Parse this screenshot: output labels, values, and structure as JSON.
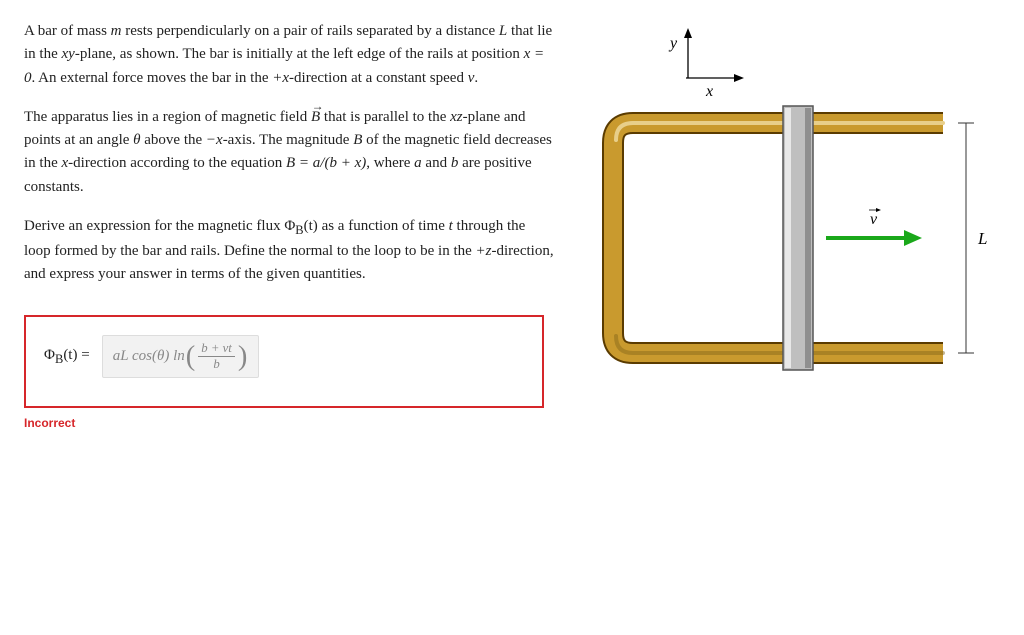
{
  "problem": {
    "p1_a": "A bar of mass ",
    "p1_b": " rests perpendicularly on a pair of rails separated by a distance ",
    "p1_c": " that lie in the ",
    "p1_d": "-plane, as shown. The bar is initially at the left edge of the rails at position ",
    "p1_e": ". An external force moves the bar in the ",
    "p1_f": "-direction at a constant speed ",
    "p1_g": ".",
    "m": "m",
    "L": "L",
    "xy": "xy",
    "x0": "x = 0",
    "plusx": "+x",
    "v": "v",
    "p2_a": "The apparatus lies in a region of magnetic field ",
    "p2_b": " that is parallel to the ",
    "p2_c": "-plane and points at an angle ",
    "p2_d": " above the ",
    "p2_e": "-axis. The magnitude ",
    "p2_f": " of the magnetic field decreases in the ",
    "p2_g": "-direction according to the equation ",
    "p2_h": ", where ",
    "p2_i": " and ",
    "p2_j": " are positive constants.",
    "Bvec": "B",
    "xz": "xz",
    "theta": "θ",
    "minusx": "−x",
    "B": "B",
    "x": "x",
    "Beq": "B = a/(b + x)",
    "a": "a",
    "b": "b",
    "p3_a": "Derive an expression for the magnetic flux ",
    "p3_b": " as a function of time ",
    "p3_c": " through the loop formed by the bar and rails. Define the normal to the loop to be in the ",
    "p3_d": "-direction, and express your answer in terms of the given quantities.",
    "Phi": "Φ",
    "Bsub": "B",
    "t_paren": "(t)",
    "t": "t",
    "plusz": "+z"
  },
  "answer": {
    "lhs_phi": "Φ",
    "lhs_bsub": "B",
    "lhs_t": "(t) =",
    "rhs_prefix": "aL cos(θ) ln",
    "frac_num": "b + vt",
    "frac_den": "b"
  },
  "feedback": {
    "label": "Incorrect"
  },
  "figure": {
    "y_label": "y",
    "x_label": "x",
    "v_label": "v",
    "L_label": "L"
  }
}
